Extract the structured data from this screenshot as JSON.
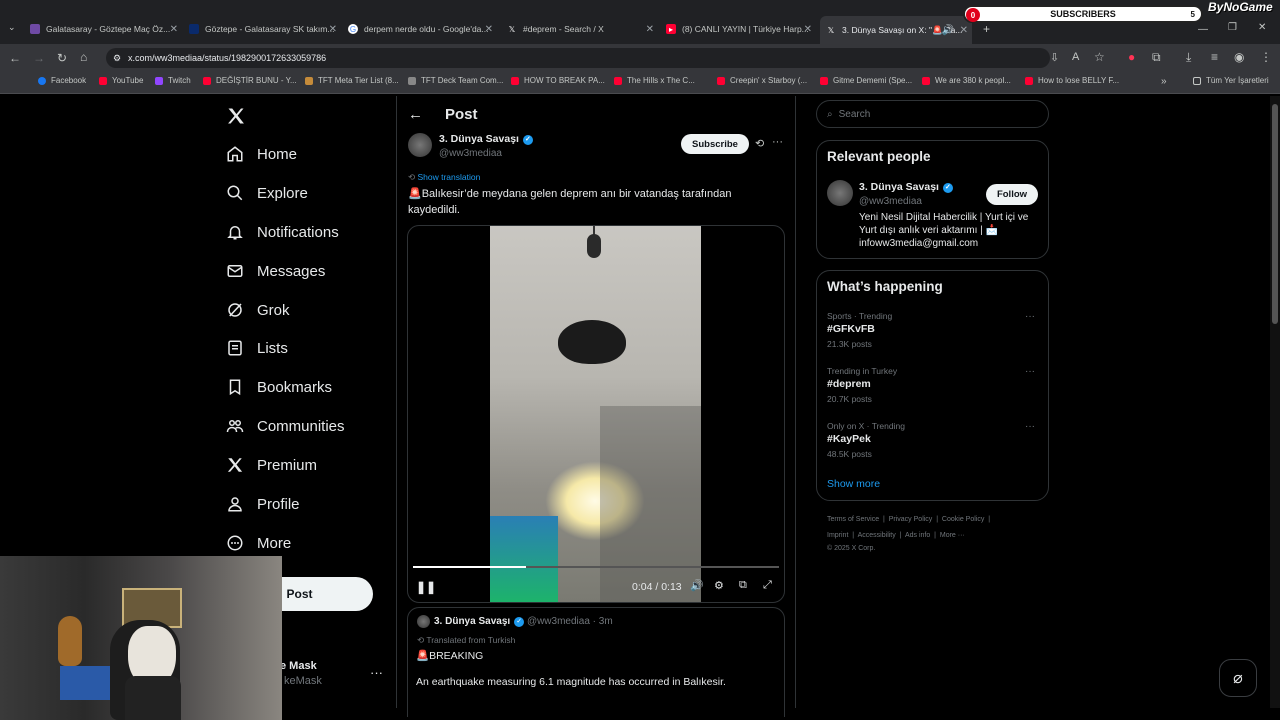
{
  "tabs": [
    {
      "title": "Galatasaray - Göztepe Maç Öz...",
      "color": "#6f4aa5"
    },
    {
      "title": "Göztepe - Galatasaray SK takım...",
      "color": "#0a2a6b"
    },
    {
      "title": "derpem nerde oldu - Google'da...",
      "color": "#4285f4"
    },
    {
      "title": "#deprem - Search / X",
      "color": "#000000"
    },
    {
      "title": "(8) CANLI YAYIN | Türkiye Harp...",
      "color": "#ff0033"
    },
    {
      "title": "3. Dünya Savaşı on X: \"🚨 Ba...",
      "color": "#000000"
    }
  ],
  "url": "x.com/ww3mediaa/status/1982900172633059786",
  "bookmarks": [
    "Facebook",
    "YouTube",
    "Twitch",
    "DEĞİŞTİR BUNU - Y...",
    "TFT Meta Tier List (8...",
    "TFT Deck Team Com...",
    "HOW TO BREAK PA...",
    "The Hills x The C...",
    "Creepin' x Starboy (...",
    "Gitme Dememi (Spe...",
    "We are 380 k peopl...",
    "How to lose BELLY F..."
  ],
  "bookmarks_all": "Tüm Yer İşaretleri",
  "overlay": {
    "count": "0",
    "label": "SUBSCRIBERS",
    "goal": "5",
    "brand": "ByNoGame"
  },
  "nav": [
    {
      "label": "Home",
      "icon": "home-icon"
    },
    {
      "label": "Explore",
      "icon": "search-icon"
    },
    {
      "label": "Notifications",
      "icon": "bell-icon"
    },
    {
      "label": "Messages",
      "icon": "mail-icon"
    },
    {
      "label": "Grok",
      "icon": "grok-icon"
    },
    {
      "label": "Lists",
      "icon": "list-icon"
    },
    {
      "label": "Bookmarks",
      "icon": "bookmark-icon"
    },
    {
      "label": "Communities",
      "icon": "people-icon"
    },
    {
      "label": "Premium",
      "icon": "x-logo-icon"
    },
    {
      "label": "Profile",
      "icon": "person-icon"
    },
    {
      "label": "More",
      "icon": "more-circle-icon"
    }
  ],
  "post_button": "Post",
  "account": {
    "name": "e Mask",
    "handle": "keMask"
  },
  "main": {
    "header": "Post",
    "author": "3. Dünya Savaşı",
    "handle": "@ww3mediaa",
    "subscribe": "Subscribe",
    "show_translation": "Show translation",
    "text": "🚨Balıkesir’de meydana gelen deprem anı bir vatandaş tarafından kaydedildi.",
    "video_time": "0:04 / 0:13",
    "video_progress": 0.31,
    "quote": {
      "author": "3. Dünya Savaşı",
      "handle": "@ww3mediaa · 3m",
      "translated": "Translated from Turkish",
      "line1": "🚨BREAKING",
      "line2": "An earthquake measuring 6.1 magnitude has occurred in Balıkesir."
    }
  },
  "right": {
    "search_placeholder": "Search",
    "relevant_title": "Relevant people",
    "person": {
      "name": "3. Dünya Savaşı",
      "handle": "@ww3mediaa",
      "follow": "Follow",
      "bio": "Yeni Nesil Dijital Habercilik | Yurt içi ve Yurt dışı anlık veri aktarımı | 📩 infoww3media@gmail.com"
    },
    "happening_title": "What’s happening",
    "trends": [
      {
        "context": "Sports · Trending",
        "tag": "#GFKvFB",
        "posts": "21.3K posts"
      },
      {
        "context": "Trending in Turkey",
        "tag": "#deprem",
        "posts": "20.7K posts"
      },
      {
        "context": "Only on X · Trending",
        "tag": "#KayPek",
        "posts": "48.5K posts"
      }
    ],
    "show_more": "Show more",
    "footer": [
      "Terms of Service",
      "Privacy Policy",
      "Cookie Policy",
      "Imprint",
      "Accessibility",
      "Ads info",
      "More ···",
      "© 2025 X Corp."
    ]
  }
}
